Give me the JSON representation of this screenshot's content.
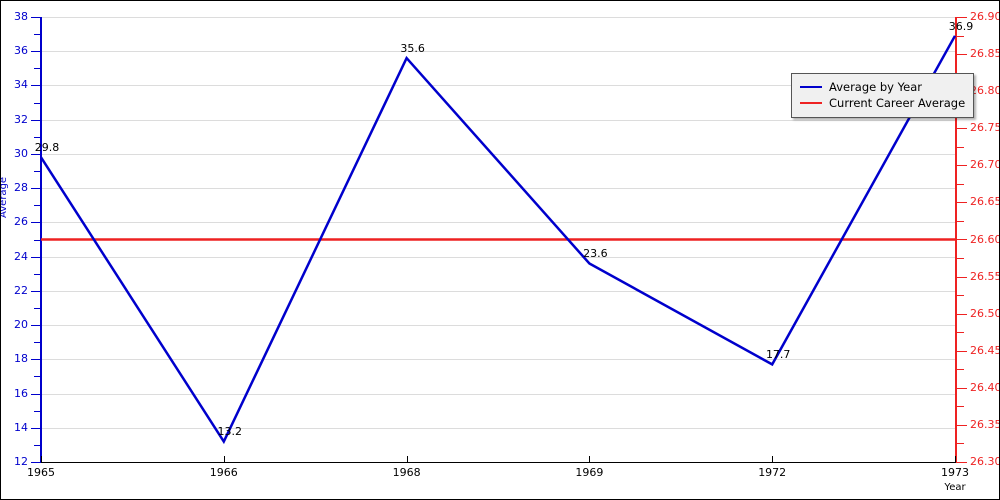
{
  "chart_data": {
    "type": "line",
    "title": "",
    "xlabel": "Year",
    "ylabel": "Average",
    "categories": [
      "1965",
      "1966",
      "1968",
      "1969",
      "1972",
      "1973"
    ],
    "series": [
      {
        "name": "Average by Year",
        "color": "#0000cc",
        "values": [
          29.8,
          13.2,
          35.6,
          23.6,
          17.7,
          36.9
        ],
        "point_labels": [
          "29.8",
          "13.2",
          "35.6",
          "23.6",
          "17.7",
          "36.9"
        ],
        "axis": "left"
      },
      {
        "name": "Current Career Average",
        "color": "#ee2222",
        "values": [
          26.6
        ],
        "constant_value": 26.6,
        "axis": "right"
      }
    ],
    "left_axis": {
      "label": "Average",
      "color": "#0000cc",
      "min": 12,
      "max": 38,
      "tick_step": 2,
      "ticks": [
        "12",
        "14",
        "16",
        "18",
        "20",
        "22",
        "24",
        "26",
        "28",
        "30",
        "32",
        "34",
        "36",
        "38"
      ]
    },
    "right_axis": {
      "label": "",
      "color": "#ee2222",
      "min": 26.3,
      "max": 26.9,
      "tick_step": 0.05,
      "ticks": [
        "26.30",
        "26.35",
        "26.40",
        "26.45",
        "26.50",
        "26.55",
        "26.60",
        "26.65",
        "26.70",
        "26.75",
        "26.80",
        "26.85",
        "26.90"
      ]
    },
    "grid": true,
    "legend_position": "top-right",
    "legend": [
      {
        "label": "Average by Year",
        "color": "#0000cc"
      },
      {
        "label": "Current Career Average",
        "color": "#ee2222"
      }
    ]
  }
}
